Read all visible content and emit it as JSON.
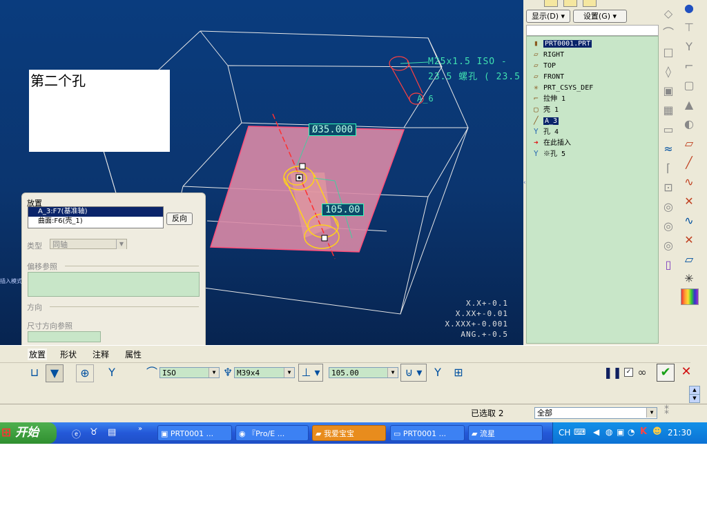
{
  "viewport": {
    "note_text": "第二个孔",
    "side_label": "插入模式",
    "annotation_line1": "M25x1.5 ISO - ",
    "annotation_line2": "23.5 螺孔 ( 23.5",
    "axis_label": "A_6",
    "dim_diameter": "Ø35.000",
    "dim_depth": "105.00",
    "tolerances": [
      "X.X+-0.1",
      "X.XX+-0.01",
      "X.XXX+-0.001",
      "ANG.+-0.5"
    ]
  },
  "placement_panel": {
    "title": "放置",
    "references": [
      "A_3:F7(基准轴)",
      "曲面:F6(壳_1)"
    ],
    "flip_button": "反向",
    "type_label": "类型",
    "type_value": "同轴",
    "offset_label": "偏移参照",
    "direction_label": "方向",
    "dim_dir_label": "尺寸方向参照"
  },
  "right_panel": {
    "display_menu": "显示(D)",
    "settings_menu": "设置(G)",
    "tree": [
      {
        "label": "PRT0001.PRT",
        "icon": "part-icon",
        "highlight": true
      },
      {
        "label": "RIGHT",
        "icon": "datum-plane-icon"
      },
      {
        "label": "TOP",
        "icon": "datum-plane-icon"
      },
      {
        "label": "FRONT",
        "icon": "datum-plane-icon"
      },
      {
        "label": "PRT_CSYS_DEF",
        "icon": "csys-icon"
      },
      {
        "label": "拉伸 1",
        "icon": "extrude-icon"
      },
      {
        "label": "壳 1",
        "icon": "shell-icon"
      },
      {
        "label": "A_3",
        "icon": "axis-icon",
        "highlight": true
      },
      {
        "label": "孔 4",
        "icon": "hole-icon"
      },
      {
        "label": "在此插入",
        "icon": "insert-arrow-icon"
      },
      {
        "label": "※孔 5",
        "icon": "hole-icon"
      }
    ]
  },
  "dashboard": {
    "tabs": [
      "放置",
      "形状",
      "注释",
      "属性"
    ],
    "standard": "ISO",
    "thread": "M39x4",
    "depth": "105.00"
  },
  "status": {
    "selected": "已选取 2",
    "filter": "全部"
  },
  "taskbar": {
    "start": "开始",
    "tasks": [
      "PRT0001 ...",
      "『Pro/E ...",
      "我爱宝宝",
      "PRT0001 ...",
      "流星"
    ],
    "lang": "CH",
    "clock": "21:30"
  }
}
